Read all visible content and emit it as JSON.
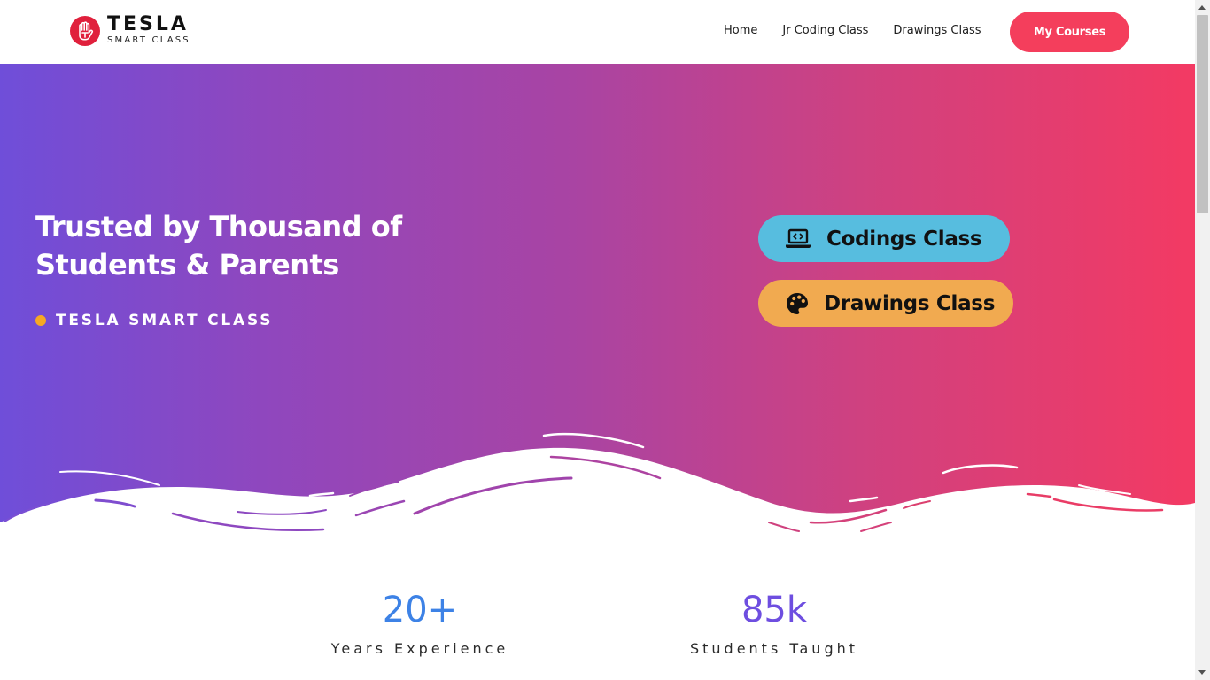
{
  "header": {
    "logo": {
      "title": "TESLA",
      "subtitle": "SMART CLASS",
      "icon": "hand-icon"
    },
    "nav": [
      "Home",
      "Jr Coding Class",
      "Drawings Class"
    ],
    "cta_label": "My Courses"
  },
  "hero": {
    "title": "Trusted by Thousand of Students & Parents",
    "tagline": "TESLA SMART CLASS",
    "buttons": [
      {
        "label": "Codings Class",
        "icon": "laptop-code-icon",
        "color": "#57bddf"
      },
      {
        "label": "Drawings Class",
        "icon": "palette-icon",
        "color": "#f1aa50"
      }
    ],
    "gradient": [
      "#6f4ed9",
      "#f33a63"
    ]
  },
  "stats": [
    {
      "value": "20+",
      "label": "Years Experience",
      "color": "#3d82e6"
    },
    {
      "value": "85k",
      "label": "Students Taught",
      "color": "#6e4ee0"
    }
  ],
  "colors": {
    "accent": "#f43e5c",
    "tag_dot": "#f7a823"
  }
}
